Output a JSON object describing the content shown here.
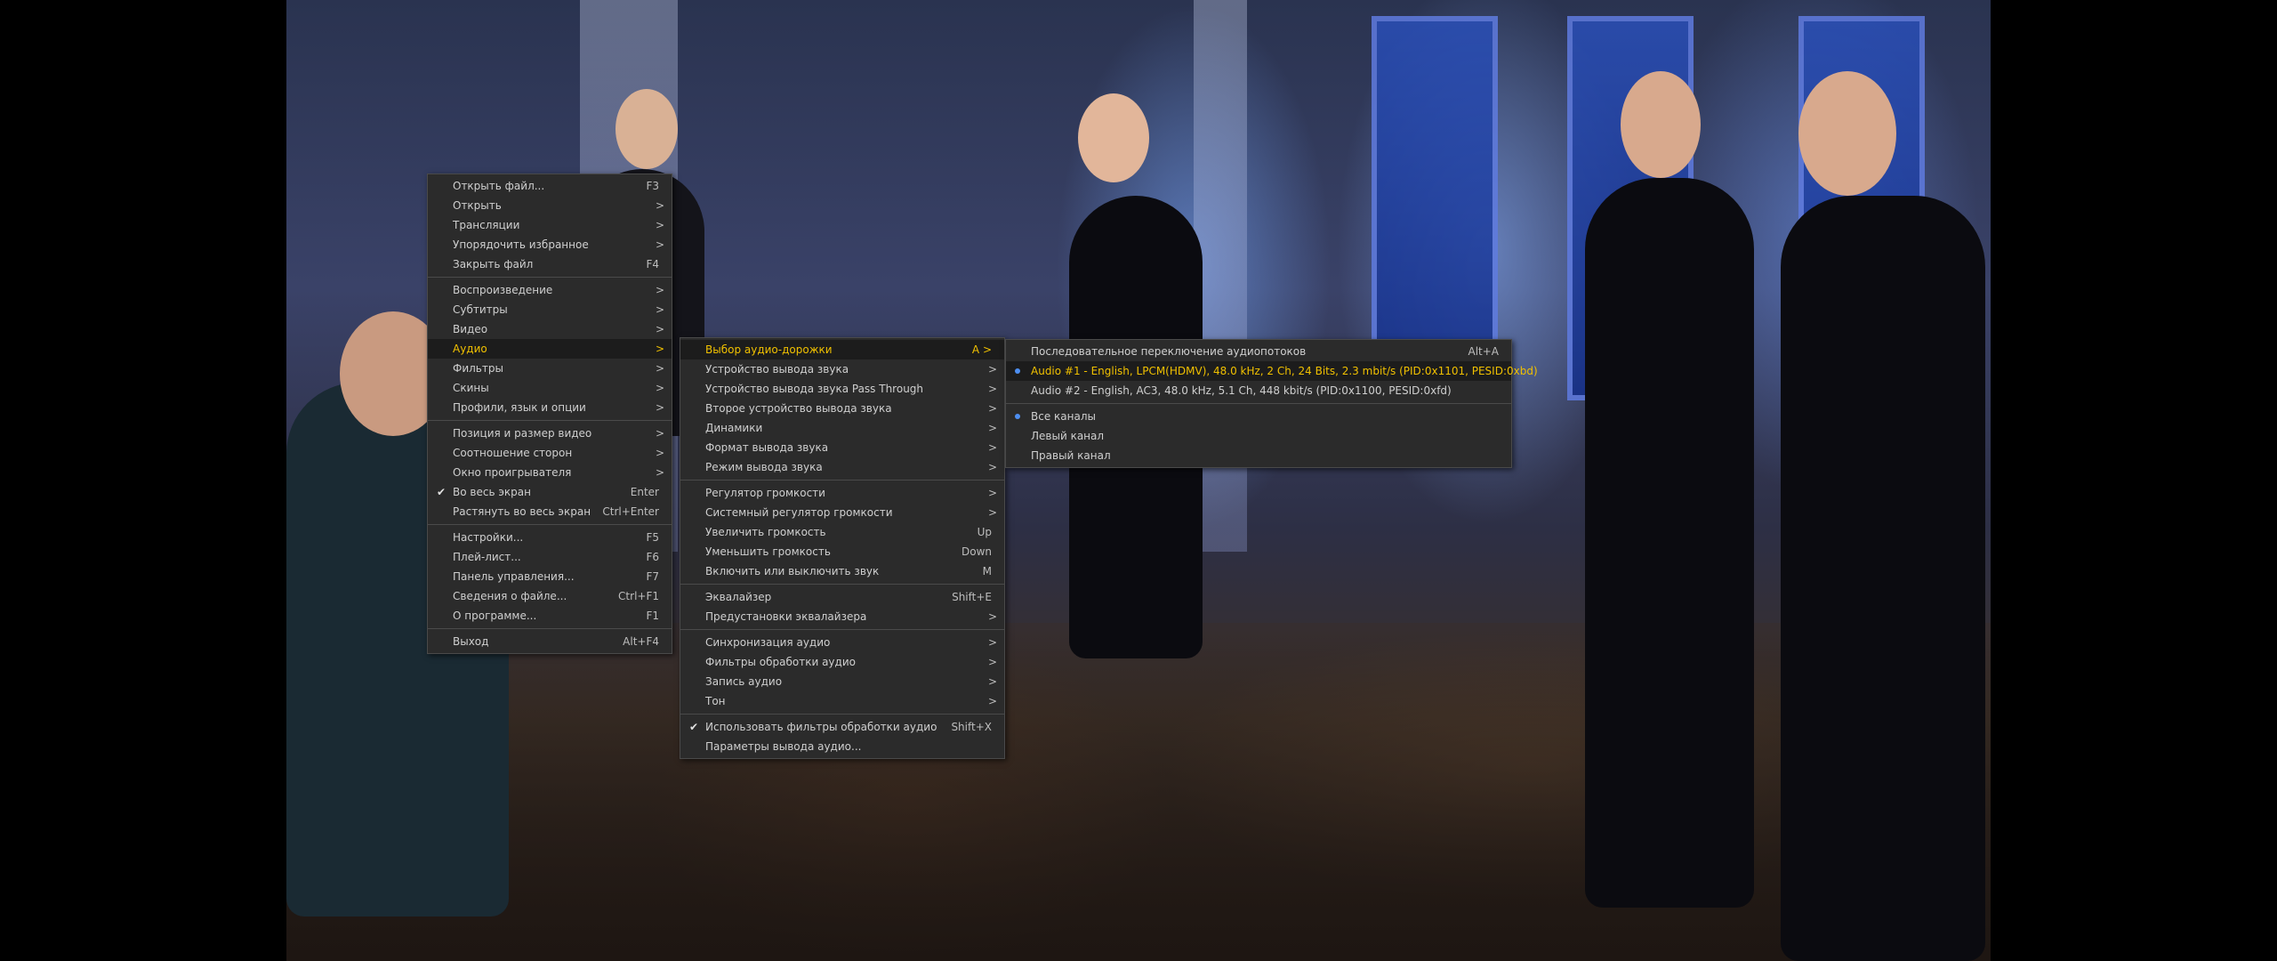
{
  "main_menu": [
    {
      "label": "Открыть файл...",
      "shortcut": "F3"
    },
    {
      "label": "Открыть",
      "arrow": ">"
    },
    {
      "label": "Трансляции",
      "arrow": ">"
    },
    {
      "label": "Упорядочить избранное",
      "arrow": ">"
    },
    {
      "label": "Закрыть файл",
      "shortcut": "F4"
    },
    {
      "sep": true
    },
    {
      "label": "Воспроизведение",
      "arrow": ">"
    },
    {
      "label": "Субтитры",
      "arrow": ">"
    },
    {
      "label": "Видео",
      "arrow": ">"
    },
    {
      "label": "Аудио",
      "arrow": ">",
      "highlight": true
    },
    {
      "label": "Фильтры",
      "arrow": ">"
    },
    {
      "label": "Скины",
      "arrow": ">"
    },
    {
      "label": "Профили, язык и опции",
      "arrow": ">"
    },
    {
      "sep": true
    },
    {
      "label": "Позиция и размер видео",
      "arrow": ">"
    },
    {
      "label": "Соотношение сторон",
      "arrow": ">"
    },
    {
      "label": "Окно проигрывателя",
      "arrow": ">"
    },
    {
      "label": "Во весь экран",
      "shortcut": "Enter",
      "checked": true
    },
    {
      "label": "Растянуть во весь экран",
      "shortcut": "Ctrl+Enter"
    },
    {
      "sep": true
    },
    {
      "label": "Настройки...",
      "shortcut": "F5"
    },
    {
      "label": "Плей-лист...",
      "shortcut": "F6"
    },
    {
      "label": "Панель управления...",
      "shortcut": "F7"
    },
    {
      "label": "Сведения о файле...",
      "shortcut": "Ctrl+F1"
    },
    {
      "label": "О программе...",
      "shortcut": "F1"
    },
    {
      "sep": true
    },
    {
      "label": "Выход",
      "shortcut": "Alt+F4"
    }
  ],
  "audio_menu": [
    {
      "label": "Выбор аудио-дорожки",
      "shortcut": "A >",
      "highlight": true
    },
    {
      "label": "Устройство вывода звука",
      "arrow": ">"
    },
    {
      "label": "Устройство вывода звука Pass Through",
      "arrow": ">"
    },
    {
      "label": "Второе устройство вывода звука",
      "arrow": ">"
    },
    {
      "label": "Динамики",
      "arrow": ">"
    },
    {
      "label": "Формат вывода звука",
      "arrow": ">"
    },
    {
      "label": "Режим вывода звука",
      "arrow": ">"
    },
    {
      "sep": true
    },
    {
      "label": "Регулятор громкости",
      "arrow": ">"
    },
    {
      "label": "Системный регулятор громкости",
      "arrow": ">"
    },
    {
      "label": "Увеличить громкость",
      "shortcut": "Up"
    },
    {
      "label": "Уменьшить громкость",
      "shortcut": "Down"
    },
    {
      "label": "Включить или выключить звук",
      "shortcut": "M"
    },
    {
      "sep": true
    },
    {
      "label": "Эквалайзер",
      "shortcut": "Shift+E"
    },
    {
      "label": "Предустановки эквалайзера",
      "arrow": ">"
    },
    {
      "sep": true
    },
    {
      "label": "Синхронизация аудио",
      "arrow": ">"
    },
    {
      "label": "Фильтры обработки аудио",
      "arrow": ">"
    },
    {
      "label": "Запись аудио",
      "arrow": ">"
    },
    {
      "label": "Тон",
      "arrow": ">"
    },
    {
      "sep": true
    },
    {
      "label": "Использовать фильтры обработки аудио",
      "shortcut": "Shift+X",
      "checked": true
    },
    {
      "label": "Параметры вывода аудио..."
    }
  ],
  "track_menu": [
    {
      "label": "Последовательное переключение аудиопотоков",
      "shortcut": "Alt+A"
    },
    {
      "label": "Audio #1 - English, LPCM(HDMV), 48.0 kHz, 2 Ch, 24 Bits, 2.3 mbit/s (PID:0x1101, PESID:0xbd)",
      "highlight": true,
      "radio": true
    },
    {
      "label": "Audio #2 - English, AC3, 48.0 kHz, 5.1 Ch, 448 kbit/s (PID:0x1100, PESID:0xfd)"
    },
    {
      "sep": true
    },
    {
      "label": "Все каналы",
      "radio": true
    },
    {
      "label": "Левый канал"
    },
    {
      "label": "Правый канал"
    }
  ]
}
